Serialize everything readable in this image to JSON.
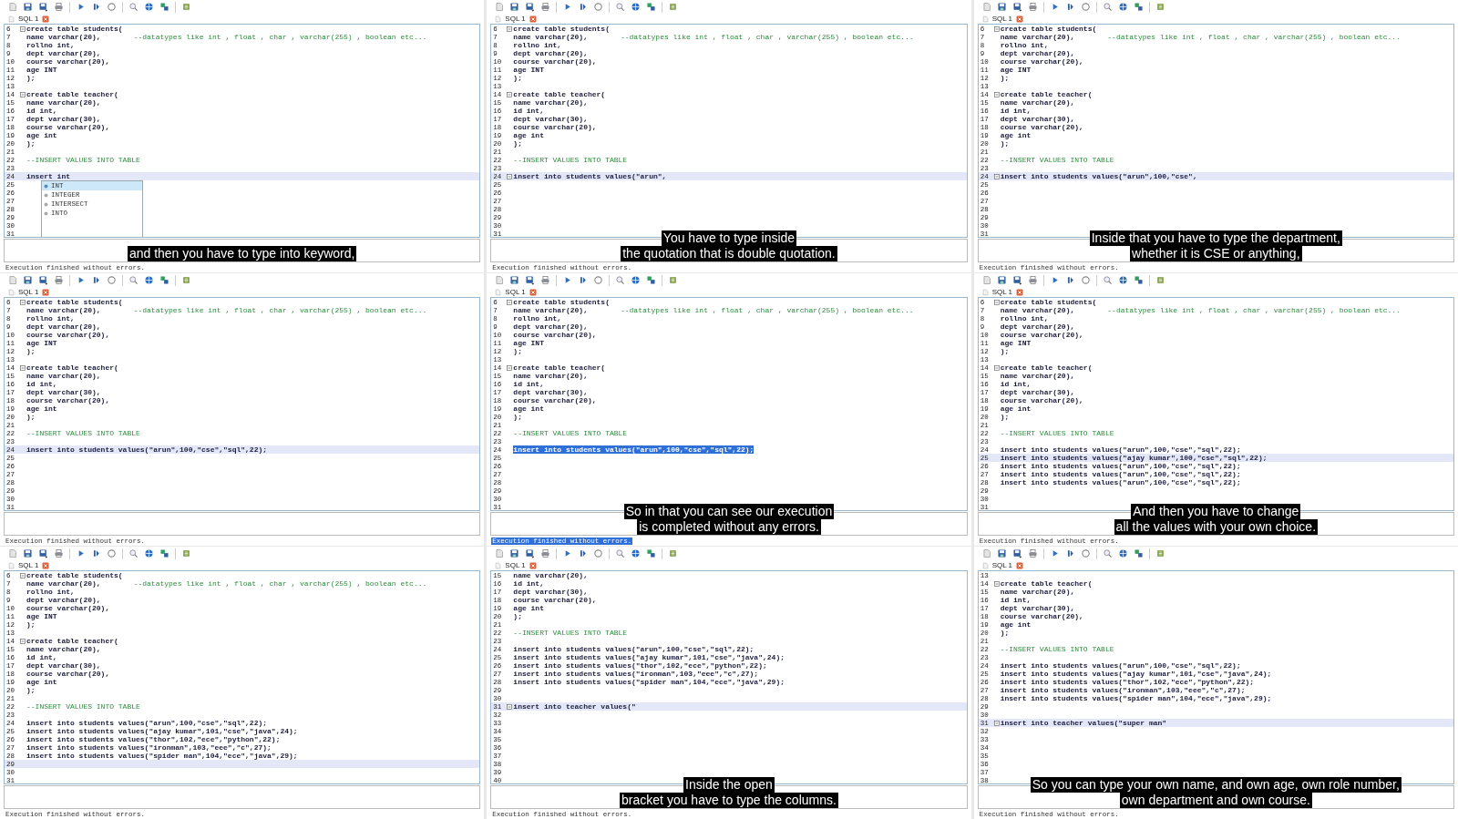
{
  "panels": [
    {
      "tab": "SQL 1",
      "lines": [
        {
          "n": "6",
          "code": "create table students(",
          "fold": true,
          "current": false,
          "selected": false
        },
        {
          "n": "7",
          "code": "name varchar(20),",
          "comment": "--datatypes like int , float , char , varchar(255) , boolean etc...",
          "fold": false,
          "current": false,
          "selected": false
        },
        {
          "n": "8",
          "code": "rollno int,",
          "fold": false,
          "current": false,
          "selected": false
        },
        {
          "n": "9",
          "code": "dept varchar(20),",
          "fold": false,
          "current": false,
          "selected": false
        },
        {
          "n": "10",
          "code": "course varchar(20),",
          "fold": false,
          "current": false,
          "selected": false
        },
        {
          "n": "11",
          "code": "age INT",
          "fold": false,
          "current": false,
          "selected": false
        },
        {
          "n": "12",
          "code": ");",
          "fold": false,
          "current": false,
          "selected": false
        },
        {
          "n": "13",
          "fold": false,
          "current": false,
          "selected": false
        },
        {
          "n": "14",
          "code": "create table teacher(",
          "fold": true,
          "current": false,
          "selected": false
        },
        {
          "n": "15",
          "code": "name varchar(20),",
          "fold": false,
          "current": false,
          "selected": false
        },
        {
          "n": "16",
          "code": "id int,",
          "fold": false,
          "current": false,
          "selected": false
        },
        {
          "n": "17",
          "code": "dept varchar(30),",
          "fold": false,
          "current": false,
          "selected": false
        },
        {
          "n": "18",
          "code": "course varchar(20),",
          "fold": false,
          "current": false,
          "selected": false
        },
        {
          "n": "19",
          "code": "age int",
          "fold": false,
          "current": false,
          "selected": false
        },
        {
          "n": "20",
          "code": ");",
          "fold": false,
          "current": false,
          "selected": false
        },
        {
          "n": "21",
          "fold": false,
          "current": false,
          "selected": false
        },
        {
          "n": "22",
          "comment": "--INSERT VALUES INTO TABLE",
          "fold": false,
          "current": false,
          "selected": false
        },
        {
          "n": "23",
          "fold": false,
          "current": false,
          "selected": false
        },
        {
          "n": "24",
          "code": "insert int",
          "fold": false,
          "current": true,
          "selected": false
        },
        {
          "n": "25",
          "fold": false,
          "current": false,
          "selected": false
        },
        {
          "n": "26",
          "fold": false,
          "current": false,
          "selected": false
        },
        {
          "n": "27",
          "fold": false,
          "current": false,
          "selected": false
        },
        {
          "n": "28",
          "fold": false,
          "current": false,
          "selected": false
        },
        {
          "n": "29",
          "fold": false,
          "current": false,
          "selected": false
        },
        {
          "n": "30",
          "fold": false,
          "current": false,
          "selected": false
        },
        {
          "n": "31",
          "fold": false,
          "current": false,
          "selected": false
        }
      ],
      "autocomplete": [
        {
          "label": "INT",
          "selected": true
        },
        {
          "label": "INTEGER",
          "selected": false
        },
        {
          "label": "INTERSECT",
          "selected": false
        },
        {
          "label": "INTO",
          "selected": false
        }
      ],
      "subtitles": [
        "and then you have to type into keyword,"
      ],
      "status": {
        "text": "Execution finished without errors.",
        "selected": false
      }
    },
    {
      "tab": "SQL 1",
      "lines": [
        {
          "n": "6",
          "code": "create table students(",
          "fold": true,
          "current": false,
          "selected": false
        },
        {
          "n": "7",
          "code": "name varchar(20),",
          "comment": "--datatypes like int , float , char , varchar(255) , boolean etc...",
          "fold": false,
          "current": false,
          "selected": false
        },
        {
          "n": "8",
          "code": "rollno int,",
          "fold": false,
          "current": false,
          "selected": false
        },
        {
          "n": "9",
          "code": "dept varchar(20),",
          "fold": false,
          "current": false,
          "selected": false
        },
        {
          "n": "10",
          "code": "course varchar(20),",
          "fold": false,
          "current": false,
          "selected": false
        },
        {
          "n": "11",
          "code": "age INT",
          "fold": false,
          "current": false,
          "selected": false
        },
        {
          "n": "12",
          "code": ");",
          "fold": false,
          "current": false,
          "selected": false
        },
        {
          "n": "13",
          "fold": false,
          "current": false,
          "selected": false
        },
        {
          "n": "14",
          "code": "create table teacher(",
          "fold": true,
          "current": false,
          "selected": false
        },
        {
          "n": "15",
          "code": "name varchar(20),",
          "fold": false,
          "current": false,
          "selected": false
        },
        {
          "n": "16",
          "code": "id int,",
          "fold": false,
          "current": false,
          "selected": false
        },
        {
          "n": "17",
          "code": "dept varchar(30),",
          "fold": false,
          "current": false,
          "selected": false
        },
        {
          "n": "18",
          "code": "course varchar(20),",
          "fold": false,
          "current": false,
          "selected": false
        },
        {
          "n": "19",
          "code": "age int",
          "fold": false,
          "current": false,
          "selected": false
        },
        {
          "n": "20",
          "code": ");",
          "fold": false,
          "current": false,
          "selected": false
        },
        {
          "n": "21",
          "fold": false,
          "current": false,
          "selected": false
        },
        {
          "n": "22",
          "comment": "--INSERT VALUES INTO TABLE",
          "fold": false,
          "current": false,
          "selected": false
        },
        {
          "n": "23",
          "fold": false,
          "current": false,
          "selected": false
        },
        {
          "n": "24",
          "code": "insert into students values(\"arun\",",
          "fold": true,
          "current": true,
          "selected": false
        },
        {
          "n": "25",
          "fold": false,
          "current": false,
          "selected": false
        },
        {
          "n": "26",
          "fold": false,
          "current": false,
          "selected": false
        },
        {
          "n": "27",
          "fold": false,
          "current": false,
          "selected": false
        },
        {
          "n": "28",
          "fold": false,
          "current": false,
          "selected": false
        },
        {
          "n": "29",
          "fold": false,
          "current": false,
          "selected": false
        },
        {
          "n": "30",
          "fold": false,
          "current": false,
          "selected": false
        },
        {
          "n": "31",
          "fold": false,
          "current": false,
          "selected": false
        }
      ],
      "subtitles": [
        "You have to type inside",
        "the quotation that is double quotation."
      ],
      "status": {
        "text": "Execution finished without errors.",
        "selected": false
      }
    },
    {
      "tab": "SQL 1",
      "lines": [
        {
          "n": "6",
          "code": "create table students(",
          "fold": true,
          "current": false,
          "selected": false
        },
        {
          "n": "7",
          "code": "name varchar(20),",
          "comment": "--datatypes like int , float , char , varchar(255) , boolean etc...",
          "fold": false,
          "current": false,
          "selected": false
        },
        {
          "n": "8",
          "code": "rollno int,",
          "fold": false,
          "current": false,
          "selected": false
        },
        {
          "n": "9",
          "code": "dept varchar(20),",
          "fold": false,
          "current": false,
          "selected": false
        },
        {
          "n": "10",
          "code": "course varchar(20),",
          "fold": false,
          "current": false,
          "selected": false
        },
        {
          "n": "11",
          "code": "age INT",
          "fold": false,
          "current": false,
          "selected": false
        },
        {
          "n": "12",
          "code": ");",
          "fold": false,
          "current": false,
          "selected": false
        },
        {
          "n": "13",
          "fold": false,
          "current": false,
          "selected": false
        },
        {
          "n": "14",
          "code": "create table teacher(",
          "fold": true,
          "current": false,
          "selected": false
        },
        {
          "n": "15",
          "code": "name varchar(20),",
          "fold": false,
          "current": false,
          "selected": false
        },
        {
          "n": "16",
          "code": "id int,",
          "fold": false,
          "current": false,
          "selected": false
        },
        {
          "n": "17",
          "code": "dept varchar(30),",
          "fold": false,
          "current": false,
          "selected": false
        },
        {
          "n": "18",
          "code": "course varchar(20),",
          "fold": false,
          "current": false,
          "selected": false
        },
        {
          "n": "19",
          "code": "age int",
          "fold": false,
          "current": false,
          "selected": false
        },
        {
          "n": "20",
          "code": ");",
          "fold": false,
          "current": false,
          "selected": false
        },
        {
          "n": "21",
          "fold": false,
          "current": false,
          "selected": false
        },
        {
          "n": "22",
          "comment": "--INSERT VALUES INTO TABLE",
          "fold": false,
          "current": false,
          "selected": false
        },
        {
          "n": "23",
          "fold": false,
          "current": false,
          "selected": false
        },
        {
          "n": "24",
          "code": "insert into students values(\"arun\",100,\"cse\",",
          "fold": true,
          "current": true,
          "selected": false
        },
        {
          "n": "25",
          "fold": false,
          "current": false,
          "selected": false
        },
        {
          "n": "26",
          "fold": false,
          "current": false,
          "selected": false
        },
        {
          "n": "27",
          "fold": false,
          "current": false,
          "selected": false
        },
        {
          "n": "28",
          "fold": false,
          "current": false,
          "selected": false
        },
        {
          "n": "29",
          "fold": false,
          "current": false,
          "selected": false
        },
        {
          "n": "30",
          "fold": false,
          "current": false,
          "selected": false
        },
        {
          "n": "31",
          "fold": false,
          "current": false,
          "selected": false
        }
      ],
      "subtitles": [
        "Inside that you have to type the department,",
        "whether it is CSE or anything,"
      ],
      "status": {
        "text": "Execution finished without errors.",
        "selected": false
      }
    },
    {
      "tab": "SQL 1",
      "lines": [
        {
          "n": "6",
          "code": "create table students(",
          "fold": true,
          "current": false,
          "selected": false
        },
        {
          "n": "7",
          "code": "name varchar(20),",
          "comment": "--datatypes like int , float , char , varchar(255) , boolean etc...",
          "fold": false,
          "current": false,
          "selected": false
        },
        {
          "n": "8",
          "code": "rollno int,",
          "fold": false,
          "current": false,
          "selected": false
        },
        {
          "n": "9",
          "code": "dept varchar(20),",
          "fold": false,
          "current": false,
          "selected": false
        },
        {
          "n": "10",
          "code": "course varchar(20),",
          "fold": false,
          "current": false,
          "selected": false
        },
        {
          "n": "11",
          "code": "age INT",
          "fold": false,
          "current": false,
          "selected": false
        },
        {
          "n": "12",
          "code": ");",
          "fold": false,
          "current": false,
          "selected": false
        },
        {
          "n": "13",
          "fold": false,
          "current": false,
          "selected": false
        },
        {
          "n": "14",
          "code": "create table teacher(",
          "fold": true,
          "current": false,
          "selected": false
        },
        {
          "n": "15",
          "code": "name varchar(20),",
          "fold": false,
          "current": false,
          "selected": false
        },
        {
          "n": "16",
          "code": "id int,",
          "fold": false,
          "current": false,
          "selected": false
        },
        {
          "n": "17",
          "code": "dept varchar(30),",
          "fold": false,
          "current": false,
          "selected": false
        },
        {
          "n": "18",
          "code": "course varchar(20),",
          "fold": false,
          "current": false,
          "selected": false
        },
        {
          "n": "19",
          "code": "age int",
          "fold": false,
          "current": false,
          "selected": false
        },
        {
          "n": "20",
          "code": ");",
          "fold": false,
          "current": false,
          "selected": false
        },
        {
          "n": "21",
          "fold": false,
          "current": false,
          "selected": false
        },
        {
          "n": "22",
          "comment": "--INSERT VALUES INTO TABLE",
          "fold": false,
          "current": false,
          "selected": false
        },
        {
          "n": "23",
          "fold": false,
          "current": false,
          "selected": false
        },
        {
          "n": "24",
          "code": "insert into students values(\"arun\",100,\"cse\",\"sql\",22);",
          "fold": false,
          "current": true,
          "selected": false
        },
        {
          "n": "25",
          "fold": false,
          "current": false,
          "selected": false
        },
        {
          "n": "26",
          "fold": false,
          "current": false,
          "selected": false
        },
        {
          "n": "27",
          "fold": false,
          "current": false,
          "selected": false
        },
        {
          "n": "28",
          "fold": false,
          "current": false,
          "selected": false
        },
        {
          "n": "29",
          "fold": false,
          "current": false,
          "selected": false
        },
        {
          "n": "30",
          "fold": false,
          "current": false,
          "selected": false
        },
        {
          "n": "31",
          "fold": false,
          "current": false,
          "selected": false
        }
      ],
      "status": {
        "text": "Execution finished without errors.",
        "selected": false
      }
    },
    {
      "tab": "SQL 1",
      "lines": [
        {
          "n": "6",
          "code": "create table students(",
          "fold": true,
          "current": false,
          "selected": false
        },
        {
          "n": "7",
          "code": "name varchar(20),",
          "comment": "--datatypes like int , float , char , varchar(255) , boolean etc...",
          "fold": false,
          "current": false,
          "selected": false
        },
        {
          "n": "8",
          "code": "rollno int,",
          "fold": false,
          "current": false,
          "selected": false
        },
        {
          "n": "9",
          "code": "dept varchar(20),",
          "fold": false,
          "current": false,
          "selected": false
        },
        {
          "n": "10",
          "code": "course varchar(20),",
          "fold": false,
          "current": false,
          "selected": false
        },
        {
          "n": "11",
          "code": "age INT",
          "fold": false,
          "current": false,
          "selected": false
        },
        {
          "n": "12",
          "code": ");",
          "fold": false,
          "current": false,
          "selected": false
        },
        {
          "n": "13",
          "fold": false,
          "current": false,
          "selected": false
        },
        {
          "n": "14",
          "code": "create table teacher(",
          "fold": true,
          "current": false,
          "selected": false
        },
        {
          "n": "15",
          "code": "name varchar(20),",
          "fold": false,
          "current": false,
          "selected": false
        },
        {
          "n": "16",
          "code": "id int,",
          "fold": false,
          "current": false,
          "selected": false
        },
        {
          "n": "17",
          "code": "dept varchar(30),",
          "fold": false,
          "current": false,
          "selected": false
        },
        {
          "n": "18",
          "code": "course varchar(20),",
          "fold": false,
          "current": false,
          "selected": false
        },
        {
          "n": "19",
          "code": "age int",
          "fold": false,
          "current": false,
          "selected": false
        },
        {
          "n": "20",
          "code": ");",
          "fold": false,
          "current": false,
          "selected": false
        },
        {
          "n": "21",
          "fold": false,
          "current": false,
          "selected": false
        },
        {
          "n": "22",
          "comment": "--INSERT VALUES INTO TABLE",
          "fold": false,
          "current": false,
          "selected": false
        },
        {
          "n": "23",
          "fold": false,
          "current": false,
          "selected": false
        },
        {
          "n": "24",
          "code": "insert into students values(\"arun\",100,\"cse\",\"sql\",22);",
          "fold": false,
          "current": false,
          "selected": true
        },
        {
          "n": "25",
          "fold": false,
          "current": false,
          "selected": false
        },
        {
          "n": "26",
          "fold": false,
          "current": false,
          "selected": false
        },
        {
          "n": "27",
          "fold": false,
          "current": false,
          "selected": false
        },
        {
          "n": "28",
          "fold": false,
          "current": false,
          "selected": false
        },
        {
          "n": "29",
          "fold": false,
          "current": false,
          "selected": false
        },
        {
          "n": "30",
          "fold": false,
          "current": false,
          "selected": false
        },
        {
          "n": "31",
          "fold": false,
          "current": false,
          "selected": false
        }
      ],
      "subtitles": [
        "So in that you can see our execution",
        "is completed without any errors."
      ],
      "status": {
        "text": "Execution finished without errors.",
        "selected": true
      }
    },
    {
      "tab": "SQL 1",
      "lines": [
        {
          "n": "6",
          "code": "create table students(",
          "fold": true,
          "current": false,
          "selected": false
        },
        {
          "n": "7",
          "code": "name varchar(20),",
          "comment": "--datatypes like int , float , char , varchar(255) , boolean etc...",
          "fold": false,
          "current": false,
          "selected": false
        },
        {
          "n": "8",
          "code": "rollno int,",
          "fold": false,
          "current": false,
          "selected": false
        },
        {
          "n": "9",
          "code": "dept varchar(20),",
          "fold": false,
          "current": false,
          "selected": false
        },
        {
          "n": "10",
          "code": "course varchar(20),",
          "fold": false,
          "current": false,
          "selected": false
        },
        {
          "n": "11",
          "code": "age INT",
          "fold": false,
          "current": false,
          "selected": false
        },
        {
          "n": "12",
          "code": ");",
          "fold": false,
          "current": false,
          "selected": false
        },
        {
          "n": "13",
          "fold": false,
          "current": false,
          "selected": false
        },
        {
          "n": "14",
          "code": "create table teacher(",
          "fold": true,
          "current": false,
          "selected": false
        },
        {
          "n": "15",
          "code": "name varchar(20),",
          "fold": false,
          "current": false,
          "selected": false
        },
        {
          "n": "16",
          "code": "id int,",
          "fold": false,
          "current": false,
          "selected": false
        },
        {
          "n": "17",
          "code": "dept varchar(30),",
          "fold": false,
          "current": false,
          "selected": false
        },
        {
          "n": "18",
          "code": "course varchar(20),",
          "fold": false,
          "current": false,
          "selected": false
        },
        {
          "n": "19",
          "code": "age int",
          "fold": false,
          "current": false,
          "selected": false
        },
        {
          "n": "20",
          "code": ");",
          "fold": false,
          "current": false,
          "selected": false
        },
        {
          "n": "21",
          "fold": false,
          "current": false,
          "selected": false
        },
        {
          "n": "22",
          "comment": "--INSERT VALUES INTO TABLE",
          "fold": false,
          "current": false,
          "selected": false
        },
        {
          "n": "23",
          "fold": false,
          "current": false,
          "selected": false
        },
        {
          "n": "24",
          "code": "insert into students values(\"arun\",100,\"cse\",\"sql\",22);",
          "fold": false,
          "current": false,
          "selected": false
        },
        {
          "n": "25",
          "code": "insert into students values(\"ajay kumar\",100,\"cse\",\"sql\",22);",
          "fold": false,
          "current": true,
          "selected": false
        },
        {
          "n": "26",
          "code": "insert into students values(\"arun\",100,\"cse\",\"sql\",22);",
          "fold": false,
          "current": false,
          "selected": false
        },
        {
          "n": "27",
          "code": "insert into students values(\"arun\",100,\"cse\",\"sql\",22);",
          "fold": false,
          "current": false,
          "selected": false
        },
        {
          "n": "28",
          "code": "insert into students values(\"arun\",100,\"cse\",\"sql\",22);",
          "fold": false,
          "current": false,
          "selected": false
        },
        {
          "n": "29",
          "fold": false,
          "current": false,
          "selected": false
        },
        {
          "n": "30",
          "fold": false,
          "current": false,
          "selected": false
        },
        {
          "n": "31",
          "fold": false,
          "current": false,
          "selected": false
        }
      ],
      "subtitles": [
        "And then you have to change",
        "all the values with your own choice."
      ],
      "status": {
        "text": "Execution finished without errors.",
        "selected": false
      }
    },
    {
      "tab": "SQL 1",
      "lines": [
        {
          "n": "6",
          "code": "create table students(",
          "fold": true,
          "current": false,
          "selected": false
        },
        {
          "n": "7",
          "code": "name varchar(20),",
          "comment": "--datatypes like int , float , char , varchar(255) , boolean etc...",
          "fold": false,
          "current": false,
          "selected": false
        },
        {
          "n": "8",
          "code": "rollno int,",
          "fold": false,
          "current": false,
          "selected": false
        },
        {
          "n": "9",
          "code": "dept varchar(20),",
          "fold": false,
          "current": false,
          "selected": false
        },
        {
          "n": "10",
          "code": "course varchar(20),",
          "fold": false,
          "current": false,
          "selected": false
        },
        {
          "n": "11",
          "code": "age INT",
          "fold": false,
          "current": false,
          "selected": false
        },
        {
          "n": "12",
          "code": ");",
          "fold": false,
          "current": false,
          "selected": false
        },
        {
          "n": "13",
          "fold": false,
          "current": false,
          "selected": false
        },
        {
          "n": "14",
          "code": "create table teacher(",
          "fold": true,
          "current": false,
          "selected": false
        },
        {
          "n": "15",
          "code": "name varchar(20),",
          "fold": false,
          "current": false,
          "selected": false
        },
        {
          "n": "16",
          "code": "id int,",
          "fold": false,
          "current": false,
          "selected": false
        },
        {
          "n": "17",
          "code": "dept varchar(30),",
          "fold": false,
          "current": false,
          "selected": false
        },
        {
          "n": "18",
          "code": "course varchar(20),",
          "fold": false,
          "current": false,
          "selected": false
        },
        {
          "n": "19",
          "code": "age int",
          "fold": false,
          "current": false,
          "selected": false
        },
        {
          "n": "20",
          "code": ");",
          "fold": false,
          "current": false,
          "selected": false
        },
        {
          "n": "21",
          "fold": false,
          "current": false,
          "selected": false
        },
        {
          "n": "22",
          "comment": "--INSERT VALUES INTO TABLE",
          "fold": false,
          "current": false,
          "selected": false
        },
        {
          "n": "23",
          "fold": false,
          "current": false,
          "selected": false
        },
        {
          "n": "24",
          "code": "insert into students values(\"arun\",100,\"cse\",\"sql\",22);",
          "fold": false,
          "current": false,
          "selected": false
        },
        {
          "n": "25",
          "code": "insert into students values(\"ajay kumar\",101,\"cse\",\"java\",24);",
          "fold": false,
          "current": false,
          "selected": false
        },
        {
          "n": "26",
          "code": "insert into students values(\"thor\",102,\"ece\",\"python\",22);",
          "fold": false,
          "current": false,
          "selected": false
        },
        {
          "n": "27",
          "code": "insert into students values(\"ironman\",103,\"eee\",\"c\",27);",
          "fold": false,
          "current": false,
          "selected": false
        },
        {
          "n": "28",
          "code": "insert into students values(\"spider man\",104,\"ece\",\"java\",29);",
          "fold": false,
          "current": false,
          "selected": false
        },
        {
          "n": "29",
          "fold": false,
          "current": true,
          "selected": false
        },
        {
          "n": "30",
          "fold": false,
          "current": false,
          "selected": false
        },
        {
          "n": "31",
          "fold": false,
          "current": false,
          "selected": false
        }
      ],
      "status": {
        "text": "Execution finished without errors.",
        "selected": false
      }
    },
    {
      "tab": "SQL 1",
      "lines": [
        {
          "n": "15",
          "code": "name varchar(20),",
          "fold": false,
          "current": false,
          "selected": false
        },
        {
          "n": "16",
          "code": "id int,",
          "fold": false,
          "current": false,
          "selected": false
        },
        {
          "n": "17",
          "code": "dept varchar(30),",
          "fold": false,
          "current": false,
          "selected": false
        },
        {
          "n": "18",
          "code": "course varchar(20),",
          "fold": false,
          "current": false,
          "selected": false
        },
        {
          "n": "19",
          "code": "age int",
          "fold": false,
          "current": false,
          "selected": false
        },
        {
          "n": "20",
          "code": ");",
          "fold": false,
          "current": false,
          "selected": false
        },
        {
          "n": "21",
          "fold": false,
          "current": false,
          "selected": false
        },
        {
          "n": "22",
          "comment": "--INSERT VALUES INTO TABLE",
          "fold": false,
          "current": false,
          "selected": false
        },
        {
          "n": "23",
          "fold": false,
          "current": false,
          "selected": false
        },
        {
          "n": "24",
          "code": "insert into students values(\"arun\",100,\"cse\",\"sql\",22);",
          "fold": false,
          "current": false,
          "selected": false
        },
        {
          "n": "25",
          "code": "insert into students values(\"ajay kumar\",101,\"cse\",\"java\",24);",
          "fold": false,
          "current": false,
          "selected": false
        },
        {
          "n": "26",
          "code": "insert into students values(\"thor\",102,\"ece\",\"python\",22);",
          "fold": false,
          "current": false,
          "selected": false
        },
        {
          "n": "27",
          "code": "insert into students values(\"ironman\",103,\"eee\",\"c\",27);",
          "fold": false,
          "current": false,
          "selected": false
        },
        {
          "n": "28",
          "code": "insert into students values(\"spider man\",104,\"ece\",\"java\",29);",
          "fold": false,
          "current": false,
          "selected": false
        },
        {
          "n": "29",
          "fold": false,
          "current": false,
          "selected": false
        },
        {
          "n": "30",
          "fold": false,
          "current": false,
          "selected": false
        },
        {
          "n": "31",
          "code": "insert into teacher values(\"",
          "fold": true,
          "current": true,
          "selected": false
        },
        {
          "n": "32",
          "fold": false,
          "current": false,
          "selected": false
        },
        {
          "n": "33",
          "fold": false,
          "current": false,
          "selected": false
        },
        {
          "n": "34",
          "fold": false,
          "current": false,
          "selected": false
        },
        {
          "n": "35",
          "fold": false,
          "current": false,
          "selected": false
        },
        {
          "n": "36",
          "fold": false,
          "current": false,
          "selected": false
        },
        {
          "n": "37",
          "fold": false,
          "current": false,
          "selected": false
        },
        {
          "n": "38",
          "fold": false,
          "current": false,
          "selected": false
        },
        {
          "n": "39",
          "fold": false,
          "current": false,
          "selected": false
        },
        {
          "n": "40",
          "fold": false,
          "current": false,
          "selected": false
        }
      ],
      "subtitles": [
        "Inside the open",
        "bracket you have to type the columns."
      ],
      "status": {
        "text": "Execution finished without errors.",
        "selected": false
      }
    },
    {
      "tab": "SQL 1",
      "lines": [
        {
          "n": "13",
          "fold": false,
          "current": false,
          "selected": false
        },
        {
          "n": "14",
          "code": "create table teacher(",
          "fold": true,
          "current": false,
          "selected": false
        },
        {
          "n": "15",
          "code": "name varchar(20),",
          "fold": false,
          "current": false,
          "selected": false
        },
        {
          "n": "16",
          "code": "id int,",
          "fold": false,
          "current": false,
          "selected": false
        },
        {
          "n": "17",
          "code": "dept varchar(30),",
          "fold": false,
          "current": false,
          "selected": false
        },
        {
          "n": "18",
          "code": "course varchar(20),",
          "fold": false,
          "current": false,
          "selected": false
        },
        {
          "n": "19",
          "code": "age int",
          "fold": false,
          "current": false,
          "selected": false
        },
        {
          "n": "20",
          "code": ");",
          "fold": false,
          "current": false,
          "selected": false
        },
        {
          "n": "21",
          "fold": false,
          "current": false,
          "selected": false
        },
        {
          "n": "22",
          "comment": "--INSERT VALUES INTO TABLE",
          "fold": false,
          "current": false,
          "selected": false
        },
        {
          "n": "23",
          "fold": false,
          "current": false,
          "selected": false
        },
        {
          "n": "24",
          "code": "insert into students values(\"arun\",100,\"cse\",\"sql\",22);",
          "fold": false,
          "current": false,
          "selected": false
        },
        {
          "n": "25",
          "code": "insert into students values(\"ajay kumar\",101,\"cse\",\"java\",24);",
          "fold": false,
          "current": false,
          "selected": false
        },
        {
          "n": "26",
          "code": "insert into students values(\"thor\",102,\"ece\",\"python\",22);",
          "fold": false,
          "current": false,
          "selected": false
        },
        {
          "n": "27",
          "code": "insert into students values(\"ironman\",103,\"eee\",\"c\",27);",
          "fold": false,
          "current": false,
          "selected": false
        },
        {
          "n": "28",
          "code": "insert into students values(\"spider man\",104,\"ece\",\"java\",29);",
          "fold": false,
          "current": false,
          "selected": false
        },
        {
          "n": "29",
          "fold": false,
          "current": false,
          "selected": false
        },
        {
          "n": "30",
          "fold": false,
          "current": false,
          "selected": false
        },
        {
          "n": "31",
          "code": "insert into teacher values(\"super man\"",
          "fold": true,
          "current": true,
          "selected": false
        },
        {
          "n": "32",
          "fold": false,
          "current": false,
          "selected": false
        },
        {
          "n": "33",
          "fold": false,
          "current": false,
          "selected": false
        },
        {
          "n": "34",
          "fold": false,
          "current": false,
          "selected": false
        },
        {
          "n": "35",
          "fold": false,
          "current": false,
          "selected": false
        },
        {
          "n": "36",
          "fold": false,
          "current": false,
          "selected": false
        },
        {
          "n": "37",
          "fold": false,
          "current": false,
          "selected": false
        },
        {
          "n": "38",
          "fold": false,
          "current": false,
          "selected": false
        }
      ],
      "subtitles": [
        "So you can type your own name, and own age, own role number,",
        "own department and own course."
      ],
      "status": {
        "text": "Execution finished without errors.",
        "selected": false
      }
    }
  ]
}
